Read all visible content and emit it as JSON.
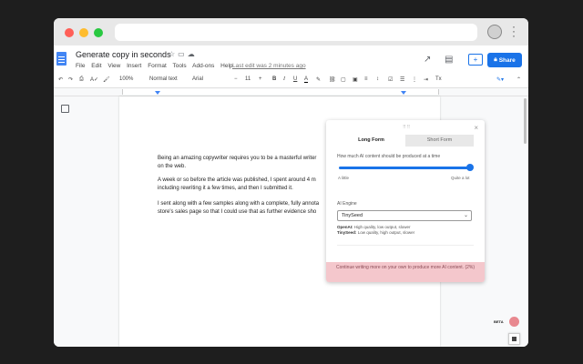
{
  "browser": {
    "dots": [
      "#ff5f57",
      "#febc2e",
      "#28c840"
    ],
    "extension_icon": "owl-icon",
    "menu_icon": "more-vert-icon"
  },
  "doc": {
    "icon": "docs-icon",
    "title": "Generate copy in seconds",
    "title_icons": [
      "star-icon",
      "folder-icon",
      "cloud-icon"
    ],
    "menu": [
      "File",
      "Edit",
      "View",
      "Insert",
      "Format",
      "Tools",
      "Add-ons",
      "Help"
    ],
    "last_edit": "Last edit was 2 minutes ago",
    "share_label": "Share",
    "accent": "#1a73e8"
  },
  "toolbar": {
    "zoom": "100%",
    "style": "Normal text",
    "font": "Arial",
    "font_size": "11"
  },
  "document": {
    "paragraphs": [
      [
        "Being an amazing copywriter requires you to be a masterful writer",
        "on the web."
      ],
      [
        "A week or so before the article was published, I spent around 4 m",
        "including rewriting it a few times, and then I submitted it."
      ],
      [
        "I sent along with a few samples along with a complete, fully annota",
        "store's sales page so that I could use that as further evidence sho"
      ]
    ]
  },
  "panel": {
    "tabs": [
      "Long Form",
      "Short Form"
    ],
    "active_tab": "Long Form",
    "amount_label": "How much AI content should be produced at a time",
    "amount_level": 1.0,
    "slider_min": "A little",
    "slider_max": "Quite a lot",
    "engine_label": "AI Engine",
    "engine_value": "TinySeed",
    "engine_notes": [
      {
        "name": "OpenAI:",
        "desc": " High quality, low output, slower"
      },
      {
        "name": "TinySeed:",
        "desc": " Low quality, high output, slower"
      }
    ],
    "footer": "Continue writing more on your own to produce more AI content. (2%)",
    "footer_color": "#f4c7cc"
  },
  "corner": {
    "beta": "BETA"
  }
}
